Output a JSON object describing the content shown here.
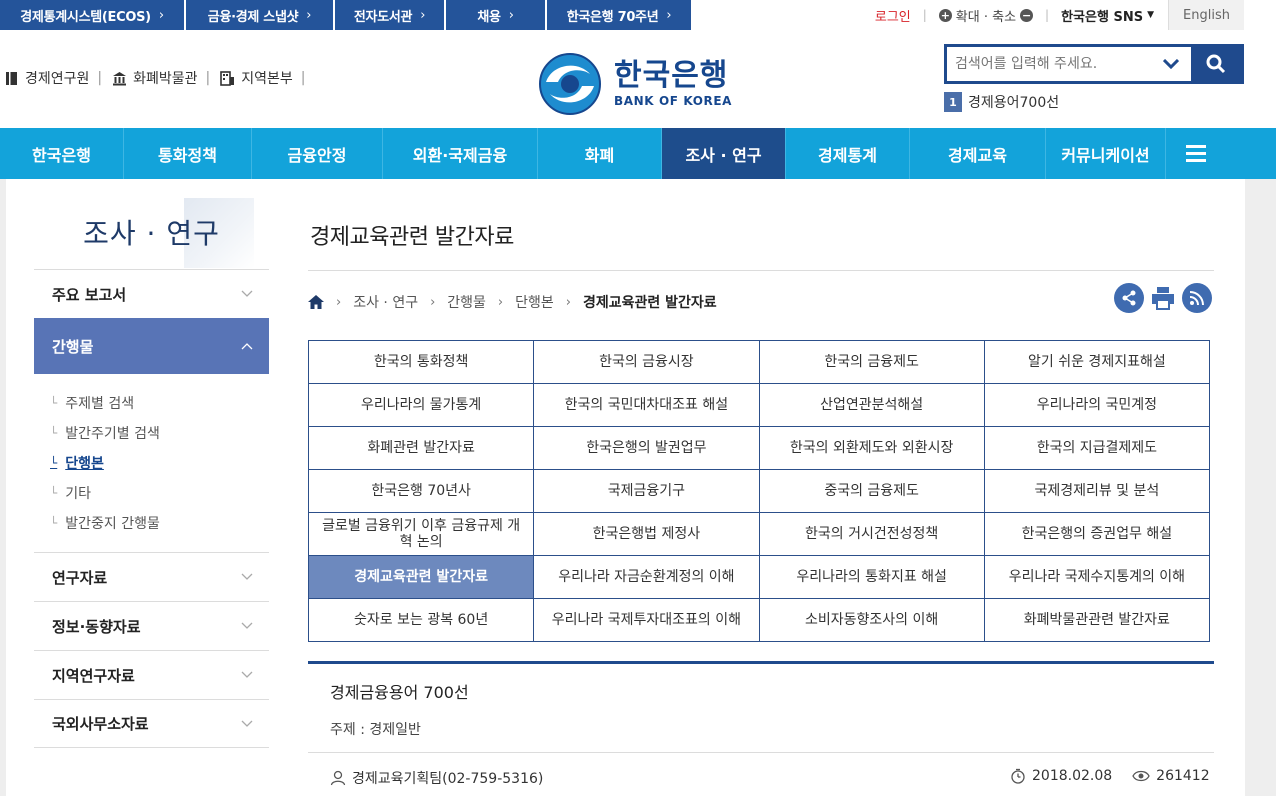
{
  "topbar": {
    "quick_links": [
      {
        "label": "경제통계시스템(ECOS)",
        "width": 184
      },
      {
        "label": "금융·경제 스냅샷",
        "width": 147
      },
      {
        "label": "전자도서관",
        "width": 109
      },
      {
        "label": "채용",
        "width": 99
      },
      {
        "label": "한국은행 70주년",
        "width": 144
      }
    ],
    "login": "로그인",
    "zoom_label": "확대 · 축소",
    "sns": "한국은행 SNS",
    "english": "English"
  },
  "header": {
    "links": [
      "경제연구원",
      "화폐박물관",
      "지역본부"
    ],
    "logo_ko": "한국은행",
    "logo_en": "BANK OF KOREA",
    "search_placeholder": "검색어를 입력해 주세요.",
    "rank_num": "1",
    "rank_text": "경제용어700선"
  },
  "gnb": [
    "한국은행",
    "통화정책",
    "금융안정",
    "외환·국제금융",
    "화폐",
    "조사 · 연구",
    "경제통계",
    "경제교육",
    "커뮤니케이션"
  ],
  "gnb_active": "조사 · 연구",
  "sidebar": {
    "title": "조사 · 연구",
    "cat_report": "주요 보고서",
    "cat_pub": "간행물",
    "sub": [
      "주제별 검색",
      "발간주기별 검색",
      "단행본",
      "기타",
      "발간중지 간행물"
    ],
    "sub_current": "단행본",
    "cats_after": [
      "연구자료",
      "정보·동향자료",
      "지역연구자료",
      "국외사무소자료"
    ]
  },
  "content": {
    "title": "경제교육관련 발간자료",
    "breadcrumb": [
      "조사 · 연구",
      "간행물",
      "단행본",
      "경제교육관련 발간자료"
    ],
    "grid": [
      [
        "한국의 통화정책",
        "한국의 금융시장",
        "한국의 금융제도",
        "알기 쉬운 경제지표해설"
      ],
      [
        "우리나라의 물가통계",
        "한국의 국민대차대조표 해설",
        "산업연관분석해설",
        "우리나라의 국민계정"
      ],
      [
        "화폐관련 발간자료",
        "한국은행의 발권업무",
        "한국의 외환제도와 외환시장",
        "한국의 지급결제제도"
      ],
      [
        "한국은행 70년사",
        "국제금융기구",
        "중국의 금융제도",
        "국제경제리뷰 및 분석"
      ],
      [
        "글로벌 금융위기 이후 금융규제 개혁 논의",
        "한국은행법 제정사",
        "한국의 거시건전성정책",
        "한국은행의 증권업무 해설"
      ],
      [
        "경제교육관련 발간자료",
        "우리나라 자금순환계정의 이해",
        "우리나라의 통화지표 해설",
        "우리나라 국제수지통계의 이해"
      ],
      [
        "숫자로 보는 광복 60년",
        "우리나라 국제투자대조표의 이해",
        "소비자동향조사의 이해",
        "화폐박물관관련 발간자료"
      ]
    ],
    "grid_selected": "경제교육관련 발간자료",
    "detail": {
      "title": "경제금융용어 700선",
      "subject": "주제 : 경제일반",
      "author": "경제교육기획팀(02-759-5316)",
      "date": "2018.02.08",
      "views": "261412"
    }
  },
  "colors": {
    "quick_bg": "#24549a",
    "gnb_bg": "#13a3da",
    "gnb_active": "#1e4d8c",
    "side_open": "#5874b6",
    "grid_sel": "#6d89be",
    "login_red": "#d8232a"
  }
}
